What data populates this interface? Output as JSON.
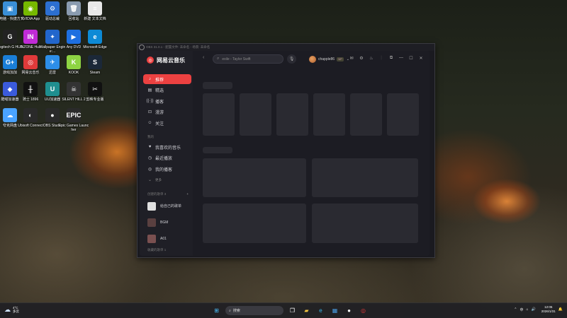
{
  "desktop": {
    "icons": [
      {
        "label": "此电脑 - 快捷方式",
        "glyph": "▣",
        "color": "#3a8fd6",
        "icon": "computer-icon"
      },
      {
        "label": "NVIDIA App",
        "glyph": "◉",
        "color": "#76b900",
        "icon": "nvidia-icon"
      },
      {
        "label": "驱动总裁",
        "glyph": "⚙",
        "color": "#2c6fd1",
        "icon": "driver-icon"
      },
      {
        "label": "回收站",
        "glyph": "🗑",
        "color": "#8a9bb0",
        "icon": "recycle-bin-icon"
      },
      {
        "label": "新建 文本文档",
        "glyph": "≡",
        "color": "#e8e8e8",
        "icon": "text-document-icon"
      },
      {
        "label": "Logitech G HUB",
        "glyph": "G",
        "color": "#222",
        "icon": "logitech-icon"
      },
      {
        "label": "INZONE Hub",
        "glyph": "IN",
        "color": "#c02bd6",
        "icon": "inzone-icon"
      },
      {
        "label": "Wallpaper Engine:...",
        "glyph": "✦",
        "color": "#2266cc",
        "icon": "wallpaper-engine-icon"
      },
      {
        "label": "Any DVD",
        "glyph": "▶",
        "color": "#1e6fe0",
        "icon": "dvd-icon"
      },
      {
        "label": "Microsoft Edge",
        "glyph": "e",
        "color": "#0d8ad6",
        "icon": "edge-icon"
      },
      {
        "label": "游戏加加",
        "glyph": "G+",
        "color": "#1a7fd8",
        "icon": "game-plus-icon"
      },
      {
        "label": "网易云音乐",
        "glyph": "◎",
        "color": "#e03a3a",
        "icon": "netease-music-icon"
      },
      {
        "label": "迅雷",
        "glyph": "✈",
        "color": "#2d8ee8",
        "icon": "xunlei-icon"
      },
      {
        "label": "KOOK",
        "glyph": "K",
        "color": "#8ed443",
        "icon": "kook-icon"
      },
      {
        "label": "Steam",
        "glyph": "S",
        "color": "#1b2838",
        "icon": "steam-icon"
      },
      {
        "label": "酷喵加速器",
        "glyph": "◆",
        "color": "#3b5bdb",
        "icon": "accelerator-icon"
      },
      {
        "label": "骑士 1896",
        "glyph": "╫",
        "color": "#111",
        "icon": "knight-icon"
      },
      {
        "label": "UU加速器",
        "glyph": "U",
        "color": "#1f8f8f",
        "icon": "uu-accelerator-icon"
      },
      {
        "label": "SILENT HILL 2",
        "glyph": "☠",
        "color": "#333",
        "icon": "silent-hill-icon"
      },
      {
        "label": "剪映专业版",
        "glyph": "✂",
        "color": "#111",
        "icon": "jianying-icon"
      },
      {
        "label": "夸克网盘",
        "glyph": "☁",
        "color": "#4aa3ff",
        "icon": "quark-icon"
      },
      {
        "label": "Ubisoft Connect",
        "glyph": "◐",
        "color": "#2a2a2a",
        "icon": "ubisoft-icon"
      },
      {
        "label": "OBS Studio",
        "glyph": "●",
        "color": "#2a2a2a",
        "icon": "obs-icon"
      },
      {
        "label": "Epic Games Launcher",
        "glyph": "EPIC",
        "color": "#2a2a2a",
        "icon": "epic-games-icon"
      }
    ]
  },
  "obs_window": {
    "title": "OBS 31.0.1 - 配置文件: 未命名 - 场景: 未命名"
  },
  "app": {
    "brand": "网易云音乐",
    "nav": [
      {
        "label": "推荐",
        "icon": "recommend-icon",
        "glyph": "♪",
        "active": true
      },
      {
        "label": "精选",
        "icon": "featured-icon",
        "glyph": "▤",
        "active": false
      },
      {
        "label": "播客",
        "icon": "podcast-icon",
        "glyph": "((·))",
        "active": false
      },
      {
        "label": "漫游",
        "icon": "roam-icon",
        "glyph": "⊡",
        "active": false
      },
      {
        "label": "关注",
        "icon": "follow-icon",
        "glyph": "☺",
        "active": false
      }
    ],
    "my_section": "我的",
    "my_items": [
      {
        "label": "我喜欢的音乐",
        "icon": "heart-icon",
        "glyph": "♥"
      },
      {
        "label": "最近播放",
        "icon": "history-icon",
        "glyph": "◷"
      },
      {
        "label": "我的播客",
        "icon": "my-podcast-icon",
        "glyph": "◎"
      }
    ],
    "more": "更多",
    "created_section": "创建的歌单 3",
    "playlists": [
      {
        "label": "给自己的歌单",
        "color": "#e0e0e0"
      },
      {
        "label": "BGM",
        "color": "#5a4040"
      },
      {
        "label": "A01",
        "color": "#7a5050"
      }
    ],
    "collected_section": "收藏的歌单 1",
    "search": {
      "placeholder": "exile - Taylor Swift"
    },
    "user": {
      "name": "chapple86",
      "badge": "VIP"
    }
  },
  "taskbar": {
    "weather_temp": "4°C",
    "weather_desc": "多云",
    "search_label": "搜索",
    "ime": "中",
    "time": "12:05",
    "date": "2026/1/31"
  }
}
